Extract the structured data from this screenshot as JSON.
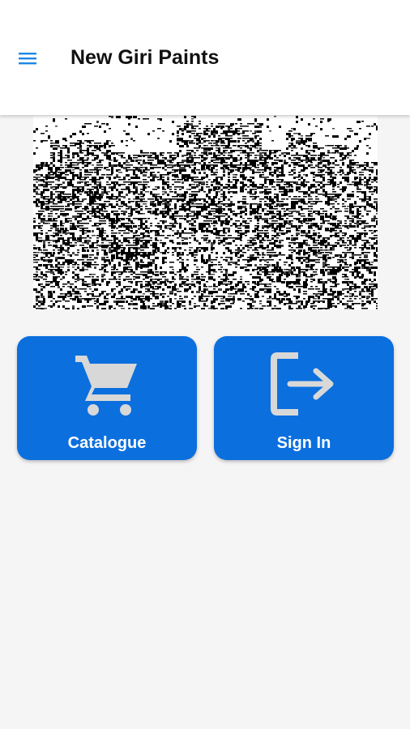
{
  "header": {
    "title": "New Giri Paints",
    "menu_icon": "hamburger-menu-icon",
    "accent_color": "#1e88e5"
  },
  "banner": {
    "description_icon": "building-banner-image"
  },
  "tiles": [
    {
      "label": "Catalogue",
      "icon": "shopping-cart-icon",
      "color": "#0b6fde"
    },
    {
      "label": "Sign In",
      "icon": "sign-in-icon",
      "color": "#0b6fde"
    }
  ]
}
